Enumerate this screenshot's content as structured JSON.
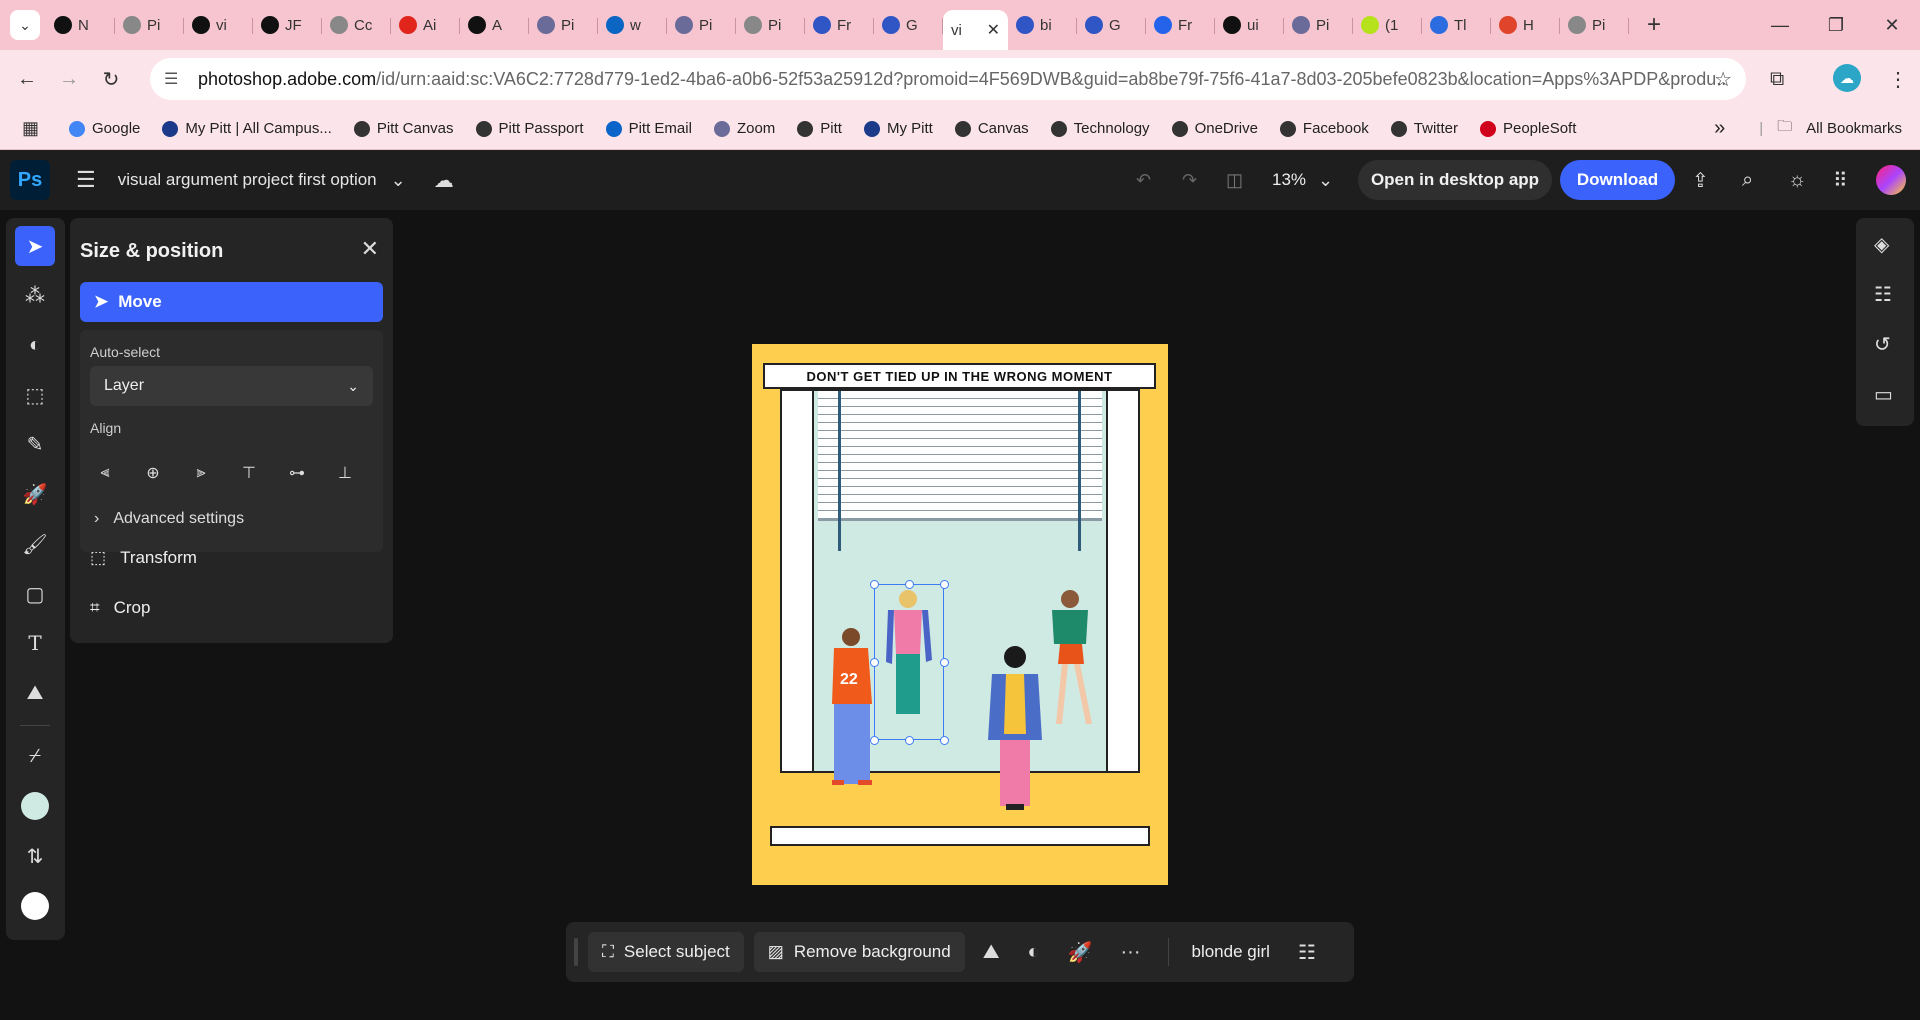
{
  "browser": {
    "tabs": [
      {
        "label": "N",
        "icon": "github-icon",
        "color": "#111"
      },
      {
        "label": "Pi",
        "icon": "globe-icon",
        "color": "#888"
      },
      {
        "label": "vi",
        "icon": "github-icon",
        "color": "#111"
      },
      {
        "label": "JF",
        "icon": "github-icon",
        "color": "#111"
      },
      {
        "label": "Cc",
        "icon": "globe-icon",
        "color": "#888"
      },
      {
        "label": "Ai",
        "icon": "adobe-icon",
        "color": "#e1251b"
      },
      {
        "label": "A",
        "icon": "app-icon",
        "color": "#111"
      },
      {
        "label": "Pi",
        "icon": "pitt-shield-icon",
        "color": "#6b6b9a"
      },
      {
        "label": "w",
        "icon": "linkedin-icon",
        "color": "#0a66c2"
      },
      {
        "label": "Pi",
        "icon": "pitt-shield-icon",
        "color": "#6b6b9a"
      },
      {
        "label": "Pi",
        "icon": "globe-icon",
        "color": "#888"
      },
      {
        "label": "Fr",
        "icon": "s-icon",
        "color": "#3056c5"
      },
      {
        "label": "G",
        "icon": "s-icon",
        "color": "#3056c5"
      },
      {
        "label": "vi",
        "icon": "",
        "color": "",
        "active": true
      },
      {
        "label": "bi",
        "icon": "s-icon",
        "color": "#3056c5"
      },
      {
        "label": "G",
        "icon": "s-icon",
        "color": "#3056c5"
      },
      {
        "label": "Fr",
        "icon": "forms-icon",
        "color": "#2563eb"
      },
      {
        "label": "ui",
        "icon": "user-icon",
        "color": "#111"
      },
      {
        "label": "Pi",
        "icon": "pitt-shield-icon",
        "color": "#6b6b9a"
      },
      {
        "label": "(1",
        "icon": "h-icon",
        "color": "#b6e21b"
      },
      {
        "label": "Tl",
        "icon": "docs-icon",
        "color": "#2b6ce0"
      },
      {
        "label": "H",
        "icon": "c-icon",
        "color": "#e0452b"
      },
      {
        "label": "Pi",
        "icon": "globe-icon",
        "color": "#888"
      }
    ],
    "url_host": "photoshop.adobe.com",
    "url_path": "/id/urn:aaid:sc:VA6C2:7728d779-1ed2-4ba6-a0b6-52f53a25912d?promoid=4F569DWB&guid=ab8be79f-75f6-41a7-8d03-205befe0823b&location=Apps%3APDP&produ...",
    "bookmarks": [
      {
        "label": "Google",
        "icon": "google-icon",
        "color": "#4285f4"
      },
      {
        "label": "My Pitt | All Campus...",
        "icon": "pitt-icon",
        "color": "#1b3a8a"
      },
      {
        "label": "Pitt Canvas",
        "icon": "globe-icon",
        "color": "#333"
      },
      {
        "label": "Pitt Passport",
        "icon": "globe-icon",
        "color": "#333"
      },
      {
        "label": "Pitt Email",
        "icon": "outlook-icon",
        "color": "#0a64c9"
      },
      {
        "label": "Zoom",
        "icon": "pitt-shield-icon",
        "color": "#6b6b9a"
      },
      {
        "label": "Pitt",
        "icon": "globe-icon",
        "color": "#333"
      },
      {
        "label": "My Pitt",
        "icon": "pitt-icon",
        "color": "#1b3a8a"
      },
      {
        "label": "Canvas",
        "icon": "globe-icon",
        "color": "#333"
      },
      {
        "label": "Technology",
        "icon": "globe-icon",
        "color": "#333"
      },
      {
        "label": "OneDrive",
        "icon": "globe-icon",
        "color": "#333"
      },
      {
        "label": "Facebook",
        "icon": "globe-icon",
        "color": "#333"
      },
      {
        "label": "Twitter",
        "icon": "globe-icon",
        "color": "#333"
      },
      {
        "label": "PeopleSoft",
        "icon": "peoplesoft-icon",
        "color": "#d0021b"
      }
    ],
    "more_bookmarks": "»",
    "all_bookmarks": "All Bookmarks"
  },
  "photoshop": {
    "logo": "Ps",
    "document_name": "visual argument project first option",
    "zoom": "13%",
    "open_desktop": "Open in desktop app",
    "download": "Download",
    "panel": {
      "title": "Size & position",
      "move": "Move",
      "auto_select_label": "Auto-select",
      "auto_select_value": "Layer",
      "align_label": "Align",
      "advanced": "Advanced settings",
      "transform": "Transform",
      "crop": "Crop"
    },
    "canvas": {
      "headline": "DON'T GET TIED UP IN THE WRONG MOMENT",
      "jersey_number": "22"
    },
    "context_bar": {
      "select_subject": "Select subject",
      "remove_background": "Remove background",
      "more": "···",
      "layer_name": "blonde girl"
    },
    "colors": {
      "accent": "#3b63fb",
      "foreground_swatch": "#cfe9e3",
      "background_swatch": "#ffffff",
      "poster_bg": "#fecf4e"
    }
  }
}
